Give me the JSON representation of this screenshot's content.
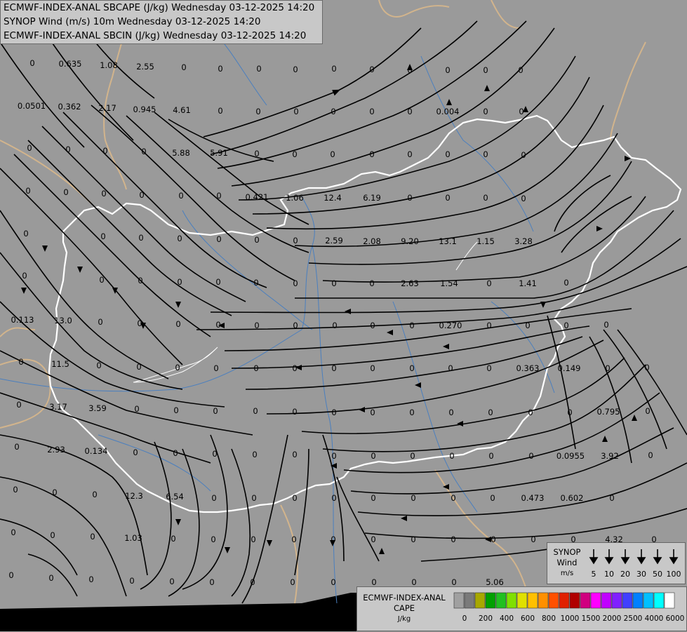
{
  "header": {
    "line1": "ECMWF-INDEX-ANAL SBCAPE (J/kg) Wednesday 03-12-2025 14:20",
    "line2": "SYNOP Wind (m/s) 10m Wednesday 03-12-2025 14:20",
    "line3": "ECMWF-INDEX-ANAL SBCIN (J/kg) Wednesday 03-12-2025 14:20"
  },
  "colors": {
    "background": "#9a9a9a",
    "country_border": "#d2b48c",
    "hungary_border": "#ffffff",
    "rivers": "#4a7fbf",
    "streamlines": "#000000"
  },
  "map_values": [
    "0",
    "0.635",
    "1.08",
    "2.55",
    "0",
    "0",
    "0",
    "0",
    "0",
    "0",
    "0",
    "0",
    "0",
    "0",
    "0.0501",
    "0.362",
    "2.17",
    "0.945",
    "4.61",
    "0",
    "0",
    "0",
    "0",
    "0",
    "0",
    "0.004",
    "0",
    "0",
    "0",
    "0",
    "0",
    "0",
    "5.88",
    "5.91",
    "0",
    "0",
    "0",
    "0",
    "0",
    "0",
    "0",
    "0",
    "0",
    "0",
    "0",
    "0",
    "0",
    "0",
    "0.421",
    "1.06",
    "12.4",
    "6.19",
    "0",
    "0",
    "0",
    "0",
    "0",
    "0",
    "0",
    "0",
    "0",
    "0",
    "0",
    "2.59",
    "2.08",
    "9.20",
    "13.1",
    "1.15",
    "3.28",
    "0",
    "0",
    "0",
    "0",
    "0",
    "0",
    "0",
    "0",
    "0",
    "2.63",
    "1.54",
    "0",
    "1.41",
    "0",
    "0.113",
    "13.0",
    "0",
    "0",
    "0",
    "0",
    "0",
    "0",
    "0",
    "0",
    "0",
    "0.270",
    "0",
    "0",
    "0",
    "0",
    "0",
    "11.5",
    "0",
    "0",
    "0",
    "0",
    "0",
    "0",
    "0",
    "0",
    "0",
    "0",
    "0",
    "0.363",
    "0.149",
    "0",
    "0",
    "0",
    "3.17",
    "3.59",
    "0",
    "0",
    "0",
    "0",
    "0",
    "0",
    "0",
    "0",
    "0",
    "0",
    "0",
    "0",
    "0.795",
    "0",
    "0",
    "2.93",
    "0.134",
    "0",
    "0",
    "0",
    "0",
    "0",
    "0",
    "0",
    "0",
    "0",
    "0",
    "0",
    "0.0955",
    "3.92",
    "0",
    "0",
    "0",
    "0",
    "12.3",
    "6.54",
    "0",
    "0",
    "0",
    "0",
    "0",
    "0",
    "0",
    "0",
    "0.473",
    "0.602",
    "0",
    "0",
    "0",
    "0",
    "1.03",
    "0",
    "0",
    "0",
    "0",
    "0",
    "0",
    "0",
    "0",
    "0",
    "0",
    "0",
    "4.32",
    "0",
    "0",
    "0",
    "0",
    "0",
    "0",
    "0",
    "0",
    "0",
    "0",
    "0",
    "0",
    "0",
    "5.06",
    "0",
    "0",
    "0",
    "0",
    "0",
    "0"
  ],
  "wind_legend": {
    "title_lines": [
      "SYNOP",
      "Wind",
      "m/s"
    ],
    "speeds": [
      "5",
      "10",
      "20",
      "30",
      "50",
      "100"
    ]
  },
  "cape_legend": {
    "title_lines": [
      "ECMWF-INDEX-ANAL",
      "CAPE",
      "J/kg"
    ],
    "ticks": [
      "0",
      "200",
      "400",
      "600",
      "800",
      "1000",
      "1500",
      "2000",
      "2500",
      "4000",
      "6000"
    ],
    "colors": [
      "#a0a0a0",
      "#7a7a7a",
      "#a8a800",
      "#00a000",
      "#20c020",
      "#80e000",
      "#e0e000",
      "#ffc000",
      "#ff9000",
      "#ff5000",
      "#e02000",
      "#b00000",
      "#d00080",
      "#ff00ff",
      "#c000ff",
      "#8020ff",
      "#4040ff",
      "#0080ff",
      "#00c0ff",
      "#00ffff",
      "#ffffff"
    ]
  }
}
